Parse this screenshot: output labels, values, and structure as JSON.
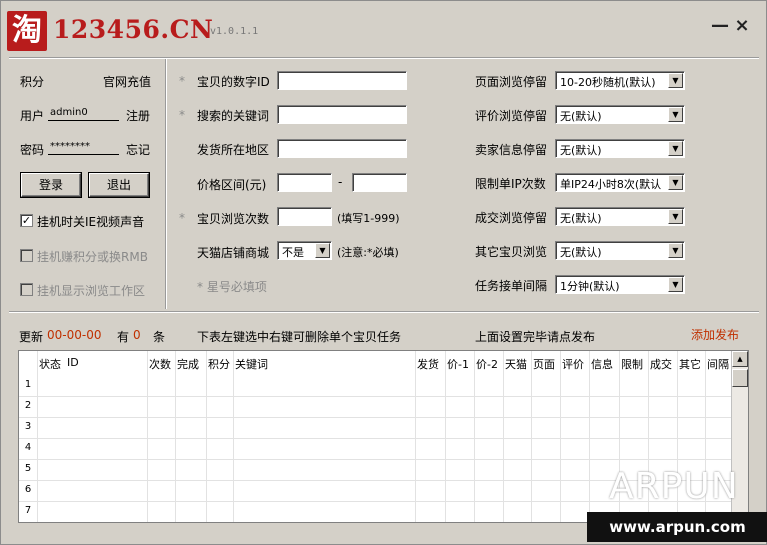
{
  "title": {
    "logo_char": "淘",
    "site": "123456.CN",
    "version": "v1.0.1.1",
    "minimize": "—",
    "close": "×"
  },
  "account": {
    "points_label": "积分",
    "recharge_link": "官网充值",
    "user_label": "用户",
    "user_value": "admin0",
    "register_link": "注册",
    "password_label": "密码",
    "password_value": "********",
    "forgot_link": "忘记",
    "login_button": "登录",
    "logout_button": "退出",
    "mute_label": "挂机时关IE视频声音",
    "mute_checked": "✓",
    "earn_label": "挂机赚积分或换RMB",
    "show_area_label": "挂机显示浏览工作区"
  },
  "form": {
    "required_mark": "*",
    "item_id_label": "宝贝的数字ID",
    "keyword_label": "搜索的关键词",
    "location_label": "发货所在地区",
    "price_label": "价格区间(元)",
    "price_sep": "-",
    "browse_count_label": "宝贝浏览次数",
    "browse_count_hint": "(填写1-999)",
    "tmall_label": "天猫店铺商城",
    "tmall_value": "不是",
    "tmall_hint": "(注意:*必填)",
    "required_note": "* 星号必填项"
  },
  "settings": {
    "rows": [
      {
        "label": "页面浏览停留",
        "value": "10-20秒随机(默认)"
      },
      {
        "label": "评价浏览停留",
        "value": "无(默认)"
      },
      {
        "label": "卖家信息停留",
        "value": "无(默认)"
      },
      {
        "label": "限制单IP次数",
        "value": "单IP24小时8次(默认"
      },
      {
        "label": "成交浏览停留",
        "value": "无(默认)"
      },
      {
        "label": "其它宝贝浏览",
        "value": "无(默认)"
      },
      {
        "label": "任务接单间隔",
        "value": "1分钟(默认)"
      }
    ]
  },
  "status": {
    "update_label": "更新",
    "update_value": "00-00-00",
    "has_label": "有",
    "count_value": "0",
    "count_unit": "条",
    "hint_delete": "下表左键选中右键可删除单个宝贝任务",
    "hint_publish": "上面设置完毕请点发布",
    "add_publish": "添加发布"
  },
  "table": {
    "headers": [
      "状态",
      "ID",
      "次数",
      "完成",
      "积分",
      "关键词",
      "发货",
      "价-1",
      "价-2",
      "天猫",
      "页面",
      "评价",
      "信息",
      "限制",
      "成交",
      "其它",
      "间隔"
    ],
    "row_numbers": [
      "1",
      "2",
      "3",
      "4",
      "5",
      "6",
      "7"
    ]
  },
  "watermark": {
    "brand": "ARPUN",
    "url": "www.arpun.com"
  }
}
